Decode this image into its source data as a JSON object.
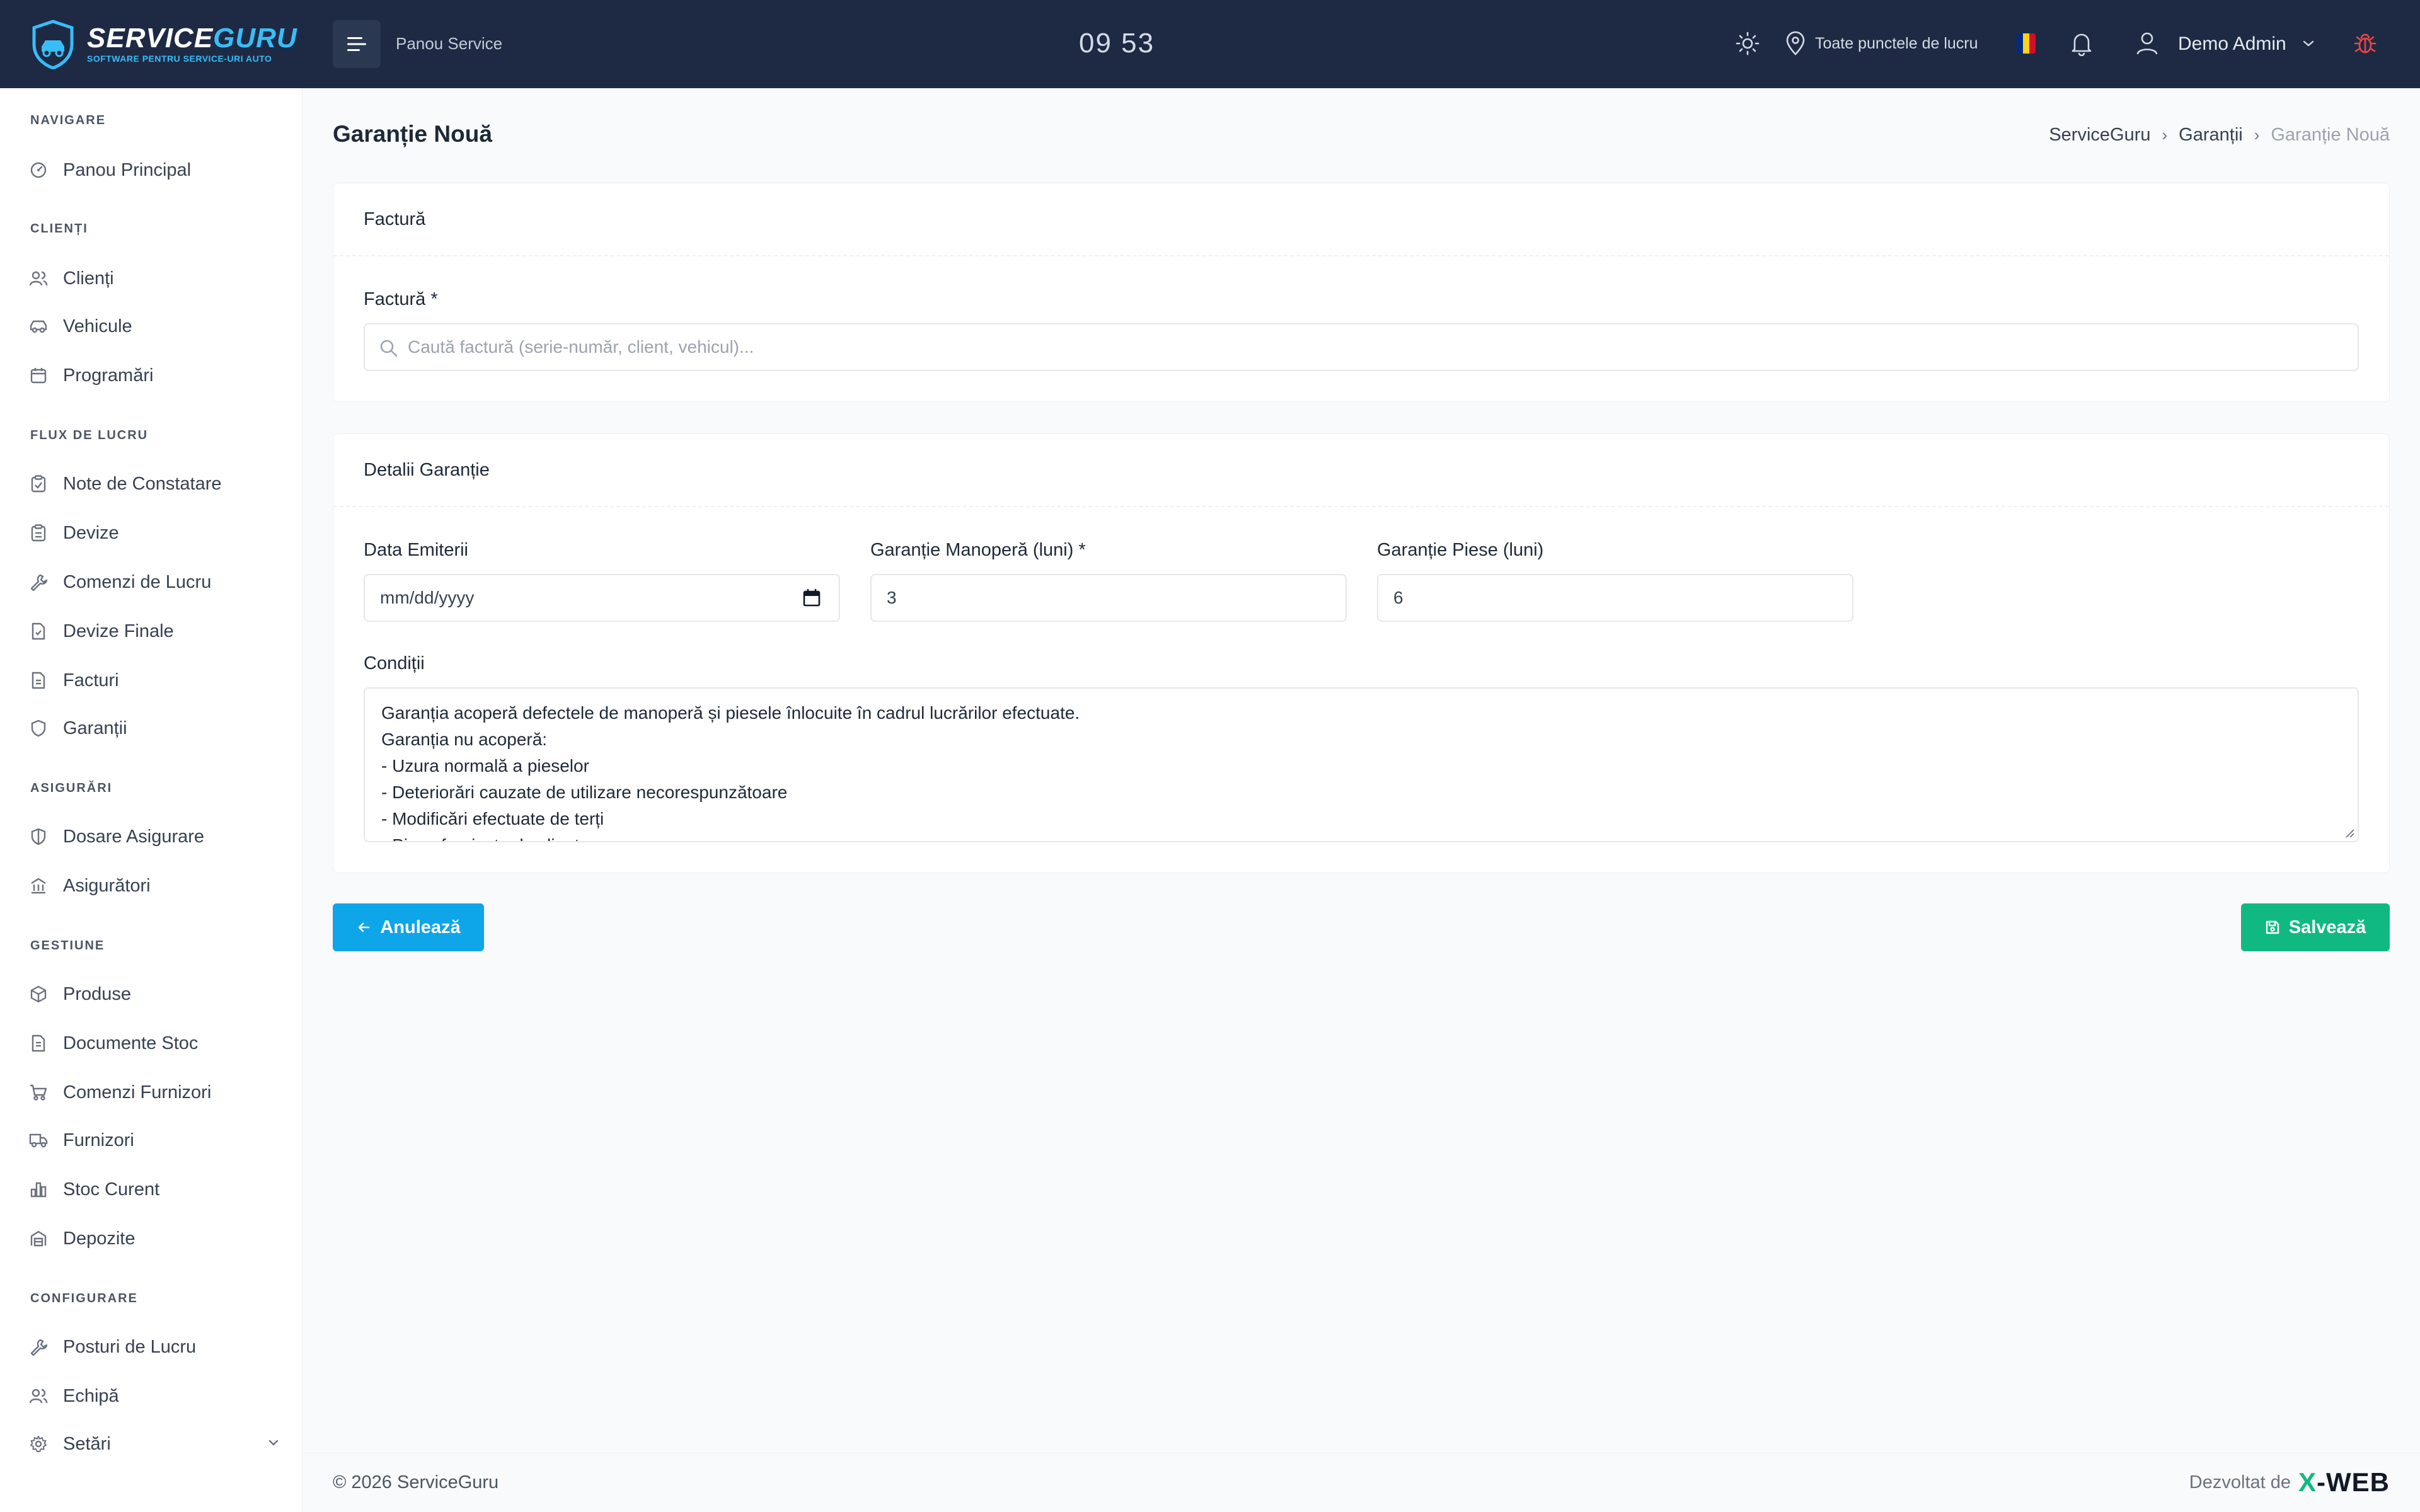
{
  "app": {
    "logo_title_a": "SERVICE",
    "logo_title_b": "GURU",
    "logo_subtitle": "SOFTWARE PENTRU SERVICE-URI AUTO"
  },
  "header": {
    "panel_label": "Panou Service",
    "clock": "09 53",
    "location": "Toate punctele de lucru",
    "user_name": "Demo Admin",
    "icons": [
      "menu-icon",
      "sun-icon",
      "map-pin-icon",
      "flag-icon",
      "bell-icon",
      "user-icon",
      "chevron-down-icon",
      "bug-icon"
    ],
    "bug_color": "#ef4444"
  },
  "sidebar": {
    "sections": [
      {
        "title": "NAVIGARE",
        "items": [
          {
            "label": "Panou Principal",
            "icon": "dashboard-icon"
          }
        ]
      },
      {
        "title": "CLIENȚI",
        "items": [
          {
            "label": "Clienți",
            "icon": "users-icon"
          },
          {
            "label": "Vehicule",
            "icon": "car-icon"
          },
          {
            "label": "Programări",
            "icon": "calendar-icon"
          }
        ]
      },
      {
        "title": "FLUX DE LUCRU",
        "items": [
          {
            "label": "Note de Constatare",
            "icon": "clipboard-icon"
          },
          {
            "label": "Devize",
            "icon": "clipboard-list-icon"
          },
          {
            "label": "Comenzi de Lucru",
            "icon": "wrench-icon"
          },
          {
            "label": "Devize Finale",
            "icon": "file-check-icon"
          },
          {
            "label": "Facturi",
            "icon": "file-text-icon"
          },
          {
            "label": "Garanții",
            "icon": "shield-icon"
          }
        ]
      },
      {
        "title": "ASIGURĂRI",
        "items": [
          {
            "label": "Dosare Asigurare",
            "icon": "shield-half-icon"
          },
          {
            "label": "Asigurători",
            "icon": "building-icon"
          }
        ]
      },
      {
        "title": "GESTIUNE",
        "items": [
          {
            "label": "Produse",
            "icon": "box-icon"
          },
          {
            "label": "Documente Stoc",
            "icon": "document-icon"
          },
          {
            "label": "Comenzi Furnizori",
            "icon": "cart-icon"
          },
          {
            "label": "Furnizori",
            "icon": "truck-icon"
          },
          {
            "label": "Stoc Curent",
            "icon": "bar-chart-icon"
          },
          {
            "label": "Depozite",
            "icon": "warehouse-icon"
          }
        ]
      },
      {
        "title": "CONFIGURARE",
        "items": [
          {
            "label": "Posturi de Lucru",
            "icon": "wrench-icon"
          },
          {
            "label": "Echipă",
            "icon": "users-icon"
          },
          {
            "label": "Setări",
            "icon": "gear-icon"
          }
        ]
      }
    ]
  },
  "page": {
    "title": "Garanție Nouă",
    "breadcrumb": [
      "ServiceGuru",
      "Garanții",
      "Garanție Nouă"
    ]
  },
  "invoice_card": {
    "header": "Factură",
    "field_label": "Factură *",
    "search_placeholder": "Caută factură (serie-număr, client, vehicul)..."
  },
  "details_card": {
    "header": "Detalii Garanție",
    "issue_date_label": "Data Emiterii",
    "issue_date_value": "mm/dd/yyyy",
    "labor_label": "Garanție Manoperă (luni) *",
    "labor_value": "3",
    "parts_label": "Garanție Piese (luni)",
    "parts_value": "6",
    "conditions_label": "Condiții",
    "conditions_lines": [
      "Garanția acoperă defectele de manoperă și piesele înlocuite în cadrul lucrărilor efectuate.",
      "Garanția nu acoperă:",
      "- Uzura normală a pieselor",
      "- Deteriorări cauzate de utilizare necorespunzătoare",
      "- Modificări efectuate de terți",
      "- Piese furnizate de client"
    ]
  },
  "actions": {
    "cancel_label": "Anulează",
    "save_label": "Salvează",
    "cancel_color": "#0ea5e9",
    "save_color": "#10b981"
  },
  "footer": {
    "copyright": "© 2026 ServiceGuru",
    "developed_by": "Dezvoltat de",
    "brand_x": "X",
    "brand_rest": "-WEB"
  }
}
